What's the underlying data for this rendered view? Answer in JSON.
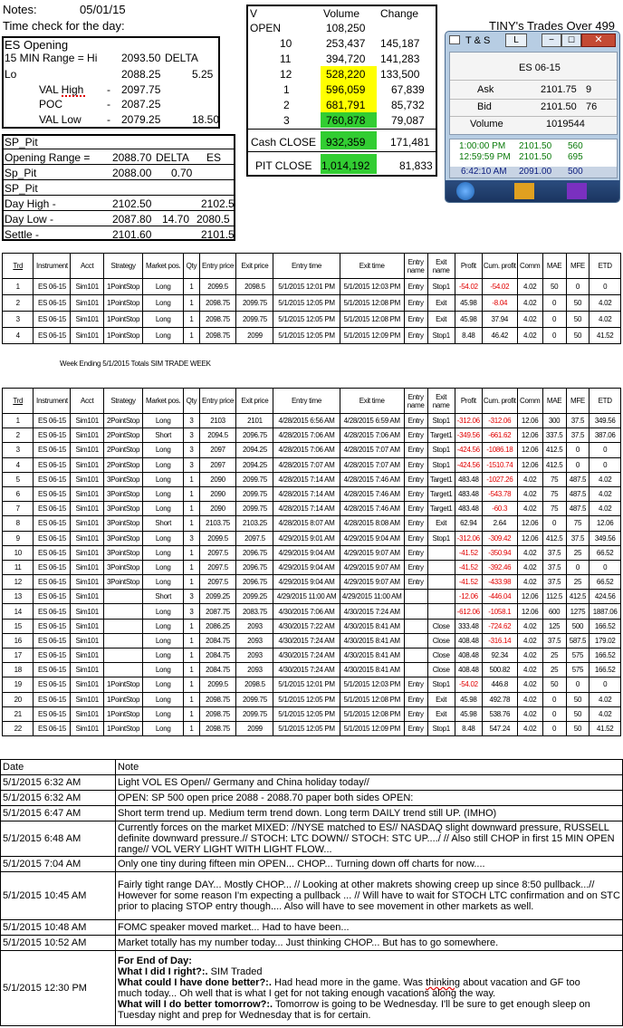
{
  "header": {
    "notes_label": "Notes:",
    "date": "05/01/15",
    "time_check": "Time check for the day:",
    "tiny_trades": "TINY's Trades Over 499"
  },
  "es_opening": {
    "title": "ES Opening",
    "range_label": "15 MIN Range = Hi",
    "range_hi": "2093.50",
    "delta_label": "DELTA",
    "lo_label": "Lo",
    "lo": "2088.25",
    "delta": "5.25",
    "val_high_label": "VAL High",
    "val_high_dash": "-",
    "val_high": "2097.75",
    "poc_label": "POC",
    "poc_dash": "-",
    "poc": "2087.25",
    "val_low_label": "VAL Low",
    "val_low_dash": "-",
    "val_low": "2079.25",
    "val_low_diff": "18.50"
  },
  "sp_pit": {
    "title": "SP_Pit",
    "opening_range_label": "Opening Range =",
    "opening_range": "2088.70",
    "delta_label": "DELTA",
    "es_label": "ES",
    "sp_pit_label": "Sp_Pit",
    "sp_pit": "2088.00",
    "delta": "0.70",
    "title2": "SP_Pit",
    "day_high_label": "Day High -",
    "day_high": "2102.50",
    "day_high_es": "2102.5",
    "day_low_label": "Day Low -",
    "day_low": "2087.80",
    "day_low_diff": "14.70",
    "day_low_es": "2080.5",
    "settle_label": "Settle -",
    "settle": "2101.60",
    "settle_es": "2101.5"
  },
  "volume": {
    "col_v": "V",
    "col_volume": "Volume",
    "col_change": "Change",
    "rows": [
      {
        "v": "OPEN",
        "vol": "108,250",
        "chg": ""
      },
      {
        "v": "10",
        "vol": "253,437",
        "chg": "145,187"
      },
      {
        "v": "11",
        "vol": "394,720",
        "chg": "141,283"
      },
      {
        "v": "12",
        "vol": "528,220",
        "chg": "133,500"
      },
      {
        "v": "1",
        "vol": "596,059",
        "chg": "67,839"
      },
      {
        "v": "2",
        "vol": "681,791",
        "chg": "85,732"
      },
      {
        "v": "3",
        "vol": "760,878",
        "chg": "79,087"
      }
    ],
    "cash_close_label": "Cash CLOSE",
    "cash_close": "932,359",
    "cash_close_chg": "171,481",
    "pit_close_label": "PIT CLOSE",
    "pit_close": "1,014,192",
    "pit_close_chg": "81,833",
    "yellow": "#ffff00",
    "green": "#32cd32"
  },
  "ts_window": {
    "title": "T & S",
    "btn_l": "L",
    "instrument": "ES 06-15",
    "ask_label": "Ask",
    "ask": "2101.75",
    "ask_size": "9",
    "bid_label": "Bid",
    "bid": "2101.50",
    "bid_size": "76",
    "volume_label": "Volume",
    "volume": "1019544",
    "ticks": [
      {
        "time": "1:00:00 PM",
        "price": "2101.50",
        "size": "560"
      },
      {
        "time": "12:59:59 PM",
        "price": "2101.50",
        "size": "695"
      },
      {
        "time": "6:42:10 AM",
        "price": "2091.00",
        "size": "500"
      }
    ]
  },
  "trade_headers": [
    "Trd",
    "Instrument",
    "Acct",
    "Strategy",
    "Market pos.",
    "Qty",
    "Entry price",
    "Exit price",
    "Entry time",
    "Exit time",
    "Entry name",
    "Exit name",
    "Profit",
    "Cum. profit",
    "Comm",
    "MAE",
    "MFE",
    "ETD"
  ],
  "trades_today": [
    [
      "1",
      "ES 06-15",
      "Sim101",
      "1PointStop",
      "Long",
      "1",
      "2099.5",
      "2098.5",
      "5/1/2015 12:01 PM",
      "5/1/2015 12:03 PM",
      "Entry",
      "Stop1",
      "-54.02",
      "-54.02",
      "4.02",
      "50",
      "0",
      "0"
    ],
    [
      "2",
      "ES 06-15",
      "Sim101",
      "1PointStop",
      "Long",
      "1",
      "2098.75",
      "2099.75",
      "5/1/2015 12:05 PM",
      "5/1/2015 12:08 PM",
      "Entry",
      "Exit",
      "45.98",
      "-8.04",
      "4.02",
      "0",
      "50",
      "4.02"
    ],
    [
      "3",
      "ES 06-15",
      "Sim101",
      "1PointStop",
      "Long",
      "1",
      "2098.75",
      "2099.75",
      "5/1/2015 12:05 PM",
      "5/1/2015 12:08 PM",
      "Entry",
      "Exit",
      "45.98",
      "37.94",
      "4.02",
      "0",
      "50",
      "4.02"
    ],
    [
      "4",
      "ES 06-15",
      "Sim101",
      "1PointStop",
      "Long",
      "1",
      "2098.75",
      "2099",
      "5/1/2015 12:05 PM",
      "5/1/2015 12:09 PM",
      "Entry",
      "Stop1",
      "8.48",
      "46.42",
      "4.02",
      "0",
      "50",
      "41.52"
    ]
  ],
  "week_label": "Week Ending 5/1/2015 Totals SIM TRADE WEEK",
  "trades_week": [
    [
      "1",
      "ES 06-15",
      "Sim101",
      "2PointStop",
      "Long",
      "3",
      "2103",
      "2101",
      "4/28/2015 6:56 AM",
      "4/28/2015 6:59 AM",
      "Entry",
      "Stop1",
      "-312.06",
      "-312.06",
      "12.06",
      "300",
      "37.5",
      "349.56"
    ],
    [
      "2",
      "ES 06-15",
      "Sim101",
      "2PointStop",
      "Short",
      "3",
      "2094.5",
      "2096.75",
      "4/28/2015 7:06 AM",
      "4/28/2015 7:06 AM",
      "Entry",
      "Target1",
      "-349.56",
      "-661.62",
      "12.06",
      "337.5",
      "37.5",
      "387.06"
    ],
    [
      "3",
      "ES 06-15",
      "Sim101",
      "2PointStop",
      "Long",
      "3",
      "2097",
      "2094.25",
      "4/28/2015 7:06 AM",
      "4/28/2015 7:07 AM",
      "Entry",
      "Stop1",
      "-424.56",
      "-1086.18",
      "12.06",
      "412.5",
      "0",
      "0"
    ],
    [
      "4",
      "ES 06-15",
      "Sim101",
      "2PointStop",
      "Long",
      "3",
      "2097",
      "2094.25",
      "4/28/2015 7:07 AM",
      "4/28/2015 7:07 AM",
      "Entry",
      "Stop1",
      "-424.56",
      "-1510.74",
      "12.06",
      "412.5",
      "0",
      "0"
    ],
    [
      "5",
      "ES 06-15",
      "Sim101",
      "3PointStop",
      "Long",
      "1",
      "2090",
      "2099.75",
      "4/28/2015 7:14 AM",
      "4/28/2015 7:46 AM",
      "Entry",
      "Target1",
      "483.48",
      "-1027.26",
      "4.02",
      "75",
      "487.5",
      "4.02"
    ],
    [
      "6",
      "ES 06-15",
      "Sim101",
      "3PointStop",
      "Long",
      "1",
      "2090",
      "2099.75",
      "4/28/2015 7:14 AM",
      "4/28/2015 7:46 AM",
      "Entry",
      "Target1",
      "483.48",
      "-543.78",
      "4.02",
      "75",
      "487.5",
      "4.02"
    ],
    [
      "7",
      "ES 06-15",
      "Sim101",
      "3PointStop",
      "Long",
      "1",
      "2090",
      "2099.75",
      "4/28/2015 7:14 AM",
      "4/28/2015 7:46 AM",
      "Entry",
      "Target1",
      "483.48",
      "-60.3",
      "4.02",
      "75",
      "487.5",
      "4.02"
    ],
    [
      "8",
      "ES 06-15",
      "Sim101",
      "3PointStop",
      "Short",
      "1",
      "2103.75",
      "2103.25",
      "4/28/2015 8:07 AM",
      "4/28/2015 8:08 AM",
      "Entry",
      "Exit",
      "62.94",
      "2.64",
      "12.06",
      "0",
      "75",
      "12.06"
    ],
    [
      "9",
      "ES 06-15",
      "Sim101",
      "3PointStop",
      "Long",
      "3",
      "2099.5",
      "2097.5",
      "4/29/2015 9:01 AM",
      "4/29/2015 9:04 AM",
      "Entry",
      "Stop1",
      "-312.06",
      "-309.42",
      "12.06",
      "412.5",
      "37.5",
      "349.56"
    ],
    [
      "10",
      "ES 06-15",
      "Sim101",
      "3PointStop",
      "Long",
      "1",
      "2097.5",
      "2096.75",
      "4/29/2015 9:04 AM",
      "4/29/2015 9:07 AM",
      "Entry",
      "",
      "-41.52",
      "-350.94",
      "4.02",
      "37.5",
      "25",
      "66.52"
    ],
    [
      "11",
      "ES 06-15",
      "Sim101",
      "3PointStop",
      "Long",
      "1",
      "2097.5",
      "2096.75",
      "4/29/2015 9:04 AM",
      "4/29/2015 9:07 AM",
      "Entry",
      "",
      "-41.52",
      "-392.46",
      "4.02",
      "37.5",
      "0",
      "0"
    ],
    [
      "12",
      "ES 06-15",
      "Sim101",
      "3PointStop",
      "Long",
      "1",
      "2097.5",
      "2096.75",
      "4/29/2015 9:04 AM",
      "4/29/2015 9:07 AM",
      "Entry",
      "",
      "-41.52",
      "-433.98",
      "4.02",
      "37.5",
      "25",
      "66.52"
    ],
    [
      "13",
      "ES 06-15",
      "Sim101",
      "",
      "Short",
      "3",
      "2099.25",
      "2099.25",
      "4/29/2015 11:00 AM",
      "4/29/2015 11:00 AM",
      "",
      "",
      "-12.06",
      "-446.04",
      "12.06",
      "112.5",
      "412.5",
      "424.56"
    ],
    [
      "14",
      "ES 06-15",
      "Sim101",
      "",
      "Long",
      "3",
      "2087.75",
      "2083.75",
      "4/30/2015 7:06 AM",
      "4/30/2015 7:24 AM",
      "",
      "",
      "-612.06",
      "-1058.1",
      "12.06",
      "600",
      "1275",
      "1887.06"
    ],
    [
      "15",
      "ES 06-15",
      "Sim101",
      "",
      "Long",
      "1",
      "2086.25",
      "2093",
      "4/30/2015 7:22 AM",
      "4/30/2015 8:41 AM",
      "",
      "Close",
      "333.48",
      "-724.62",
      "4.02",
      "125",
      "500",
      "166.52"
    ],
    [
      "16",
      "ES 06-15",
      "Sim101",
      "",
      "Long",
      "1",
      "2084.75",
      "2093",
      "4/30/2015 7:24 AM",
      "4/30/2015 8:41 AM",
      "",
      "Close",
      "408.48",
      "-316.14",
      "4.02",
      "37.5",
      "587.5",
      "179.02"
    ],
    [
      "17",
      "ES 06-15",
      "Sim101",
      "",
      "Long",
      "1",
      "2084.75",
      "2093",
      "4/30/2015 7:24 AM",
      "4/30/2015 8:41 AM",
      "",
      "Close",
      "408.48",
      "92.34",
      "4.02",
      "25",
      "575",
      "166.52"
    ],
    [
      "18",
      "ES 06-15",
      "Sim101",
      "",
      "Long",
      "1",
      "2084.75",
      "2093",
      "4/30/2015 7:24 AM",
      "4/30/2015 8:41 AM",
      "",
      "Close",
      "408.48",
      "500.82",
      "4.02",
      "25",
      "575",
      "166.52"
    ],
    [
      "19",
      "ES 06-15",
      "Sim101",
      "1PointStop",
      "Long",
      "1",
      "2099.5",
      "2098.5",
      "5/1/2015 12:01 PM",
      "5/1/2015 12:03 PM",
      "Entry",
      "Stop1",
      "-54.02",
      "446.8",
      "4.02",
      "50",
      "0",
      "0"
    ],
    [
      "20",
      "ES 06-15",
      "Sim101",
      "1PointStop",
      "Long",
      "1",
      "2098.75",
      "2099.75",
      "5/1/2015 12:05 PM",
      "5/1/2015 12:08 PM",
      "Entry",
      "Exit",
      "45.98",
      "492.78",
      "4.02",
      "0",
      "50",
      "4.02"
    ],
    [
      "21",
      "ES 06-15",
      "Sim101",
      "1PointStop",
      "Long",
      "1",
      "2098.75",
      "2099.75",
      "5/1/2015 12:05 PM",
      "5/1/2015 12:08 PM",
      "Entry",
      "Exit",
      "45.98",
      "538.76",
      "4.02",
      "0",
      "50",
      "4.02"
    ],
    [
      "22",
      "ES 06-15",
      "Sim101",
      "1PointStop",
      "Long",
      "1",
      "2098.75",
      "2099",
      "5/1/2015 12:05 PM",
      "5/1/2015 12:09 PM",
      "Entry",
      "Stop1",
      "8.48",
      "547.24",
      "4.02",
      "0",
      "50",
      "41.52"
    ]
  ],
  "notes_table": {
    "date_header": "Date",
    "note_header": "Note",
    "rows": [
      {
        "date": "5/1/2015 6:32 AM",
        "lines": [
          "Light VOL ES Open// Germany and China holiday today//"
        ]
      },
      {
        "date": "5/1/2015 6:32 AM",
        "lines": [
          "OPEN: SP 500 open price 2088 - 2088.70 paper both sides OPEN:"
        ]
      },
      {
        "date": "5/1/2015 6:47 AM",
        "lines": [
          "Short term trend up.  Medium term trend down.  Long term DAILY trend still UP. (IMHO)"
        ]
      },
      {
        "date": "5/1/2015 6:48 AM",
        "lines": [
          "Currently forces on the market MIXED: //NYSE matched to ES// NASDAQ slight downward pressure, RUSSELL",
          "definite downward pressure.// STOCH: LTC DOWN// STOCH: STC UP..../ // Also still CHOP in first 15 MIN OPEN",
          "range// VOL VERY LIGHT WITH LIGHT FLOW..."
        ]
      },
      {
        "date": "5/1/2015 7:04 AM",
        "lines": [
          "Only one tiny during fifteen min OPEN... CHOP... Turning down off charts for now...."
        ]
      },
      {
        "date": "5/1/2015 10:45 AM",
        "lines": [
          "Fairly tight range DAY... Mostly CHOP... // Looking at other makrets showing creep up since 8:50 pullback...//",
          "However for some reason I'm expecting a pullback ... // Will have to wait for STOCH LTC confirmation and on STC",
          "prior to placing STOP entry though.... Also will have to see movement in other markets as well."
        ]
      },
      {
        "date": "5/1/2015 10:48 AM",
        "lines": [
          "FOMC speaker moved market... Had to have been..."
        ]
      },
      {
        "date": "5/1/2015 10:52 AM",
        "lines": [
          "Market totally has my number today... Just thinking CHOP... But has to go somewhere."
        ]
      }
    ],
    "last_row": {
      "date": "5/1/2015 12:30 PM",
      "end_of_day": "For End of Day:",
      "q1": "What I did I right?:.",
      "a1": "  SIM Traded",
      "q2": "What could I have done better?:.",
      "a2a": "  Had head more in the game.  Was ",
      "a2b": "thinking",
      "a2c": " about vacation and GF too",
      "a2d": "much today... Oh well that is what I get for not taking enough vacations along the way.",
      "q3": "What will I do better tomorrow?:.",
      "a3": "  Tomorrow is going to be Wednesday.  I'll be sure to get enough sleep on",
      "a3b": "Tuesday night and prep for Wednesday that is for certain."
    }
  }
}
